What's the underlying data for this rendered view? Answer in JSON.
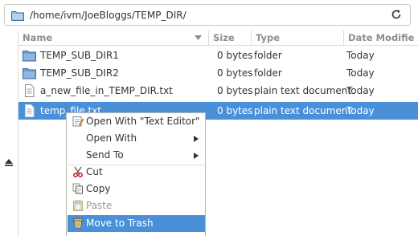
{
  "path_bar": {
    "path": "/home/ivm/JoeBloggs/TEMP_DIR/"
  },
  "columns": {
    "name": "Name",
    "size": "Size",
    "type": "Type",
    "date": "Date Modifie"
  },
  "files": [
    {
      "name": "TEMP_SUB_DIR1",
      "size": "0 bytes",
      "type": "folder",
      "date": "Today",
      "icon": "folder-icon"
    },
    {
      "name": "TEMP_SUB_DIR2",
      "size": "0 bytes",
      "type": "folder",
      "date": "Today",
      "icon": "folder-icon"
    },
    {
      "name": "a_new_file_in_TEMP_DIR.txt",
      "size": "0 bytes",
      "type": "plain text document",
      "date": "Today",
      "icon": "text-file-icon"
    },
    {
      "name": "temp_file.txt",
      "size": "0 bytes",
      "type": "plain text document",
      "date": "Today",
      "icon": "text-file-icon",
      "selected": true
    }
  ],
  "context_menu": {
    "open_with_text_editor": "Open With \"Text Editor\"",
    "open_with": "Open With",
    "send_to": "Send To",
    "cut": "Cut",
    "copy": "Copy",
    "paste": "Paste",
    "move_to_trash": "Move to Trash"
  },
  "colors": {
    "selection": "#4a90d9",
    "folder": "#5c8fc4"
  }
}
